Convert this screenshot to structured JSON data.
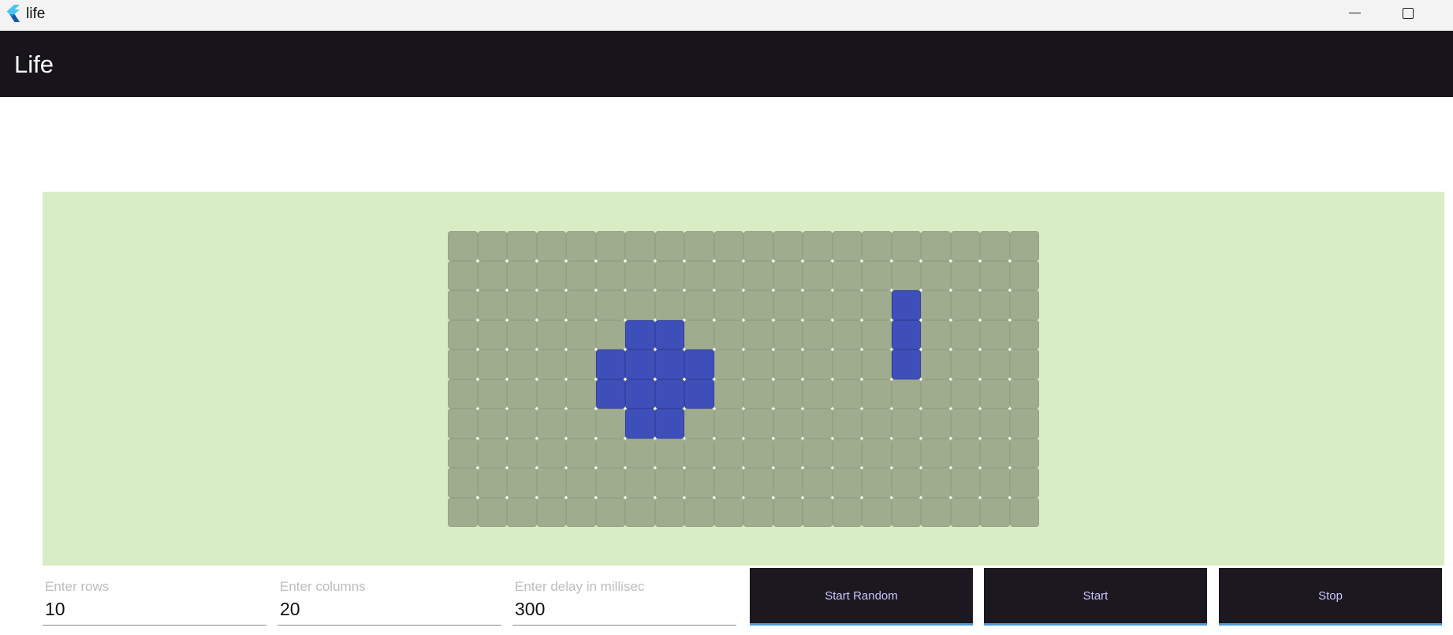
{
  "window": {
    "title": "life"
  },
  "appbar": {
    "title": "Life"
  },
  "board": {
    "rows": 10,
    "columns": 20,
    "alive_cells": [
      [
        2,
        15
      ],
      [
        3,
        6
      ],
      [
        3,
        7
      ],
      [
        3,
        15
      ],
      [
        4,
        5
      ],
      [
        4,
        6
      ],
      [
        4,
        7
      ],
      [
        4,
        8
      ],
      [
        4,
        15
      ],
      [
        5,
        5
      ],
      [
        5,
        6
      ],
      [
        5,
        7
      ],
      [
        5,
        8
      ],
      [
        6,
        6
      ],
      [
        6,
        7
      ]
    ],
    "colors": {
      "area": "#d9edc5",
      "dead": "#a0ac8e",
      "alive": "#3f4fb9"
    }
  },
  "controls": {
    "rows": {
      "label": "Enter rows",
      "value": "10"
    },
    "columns": {
      "label": "Enter columns",
      "value": "20"
    },
    "delay": {
      "label": "Enter delay in millisec",
      "value": "300"
    },
    "start_random_label": "Start Random",
    "start_label": "Start",
    "stop_label": "Stop"
  }
}
